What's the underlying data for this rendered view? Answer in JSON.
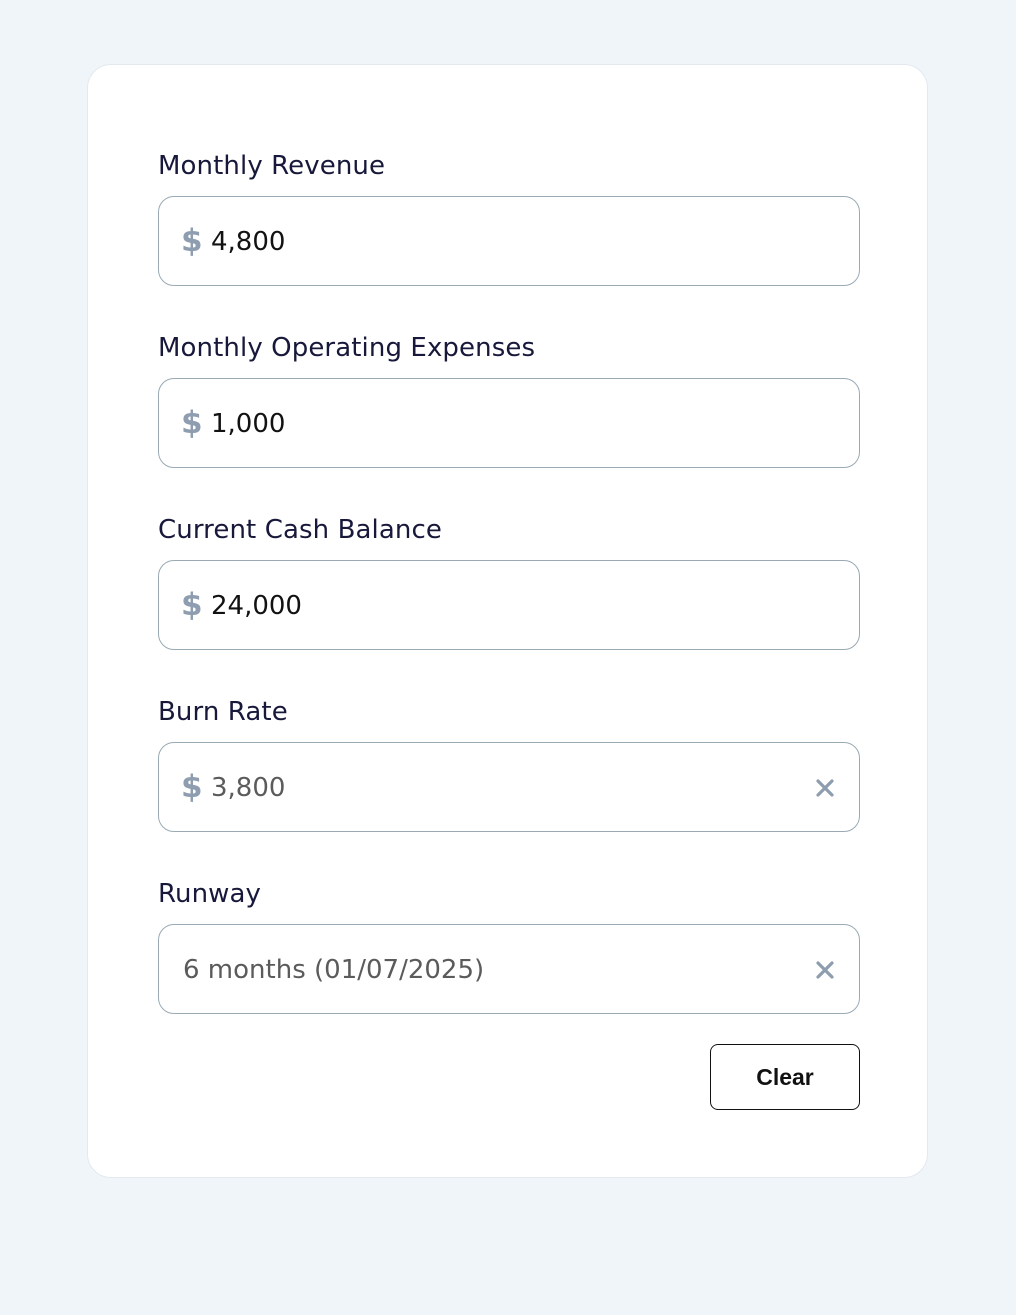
{
  "colors": {
    "page_background": "#f0f5f9",
    "card_background": "#ffffff",
    "label_text": "#17183a",
    "input_border": "#9aaab4",
    "icon_color": "#8e9daf",
    "value_text": "#121212",
    "readonly_value_text": "#5b5b5b"
  },
  "fields": {
    "monthly_revenue": {
      "label": "Monthly Revenue",
      "currency_symbol": "$",
      "value": "4,800"
    },
    "monthly_operating_expenses": {
      "label": "Monthly Operating Expenses",
      "currency_symbol": "$",
      "value": "1,000"
    },
    "current_cash_balance": {
      "label": "Current Cash Balance",
      "currency_symbol": "$",
      "value": "24,000"
    },
    "burn_rate": {
      "label": "Burn Rate",
      "currency_symbol": "$",
      "value": "3,800",
      "clear_icon": "close-icon"
    },
    "runway": {
      "label": "Runway",
      "value": "6 months (01/07/2025)",
      "clear_icon": "close-icon"
    }
  },
  "actions": {
    "clear_label": "Clear"
  }
}
